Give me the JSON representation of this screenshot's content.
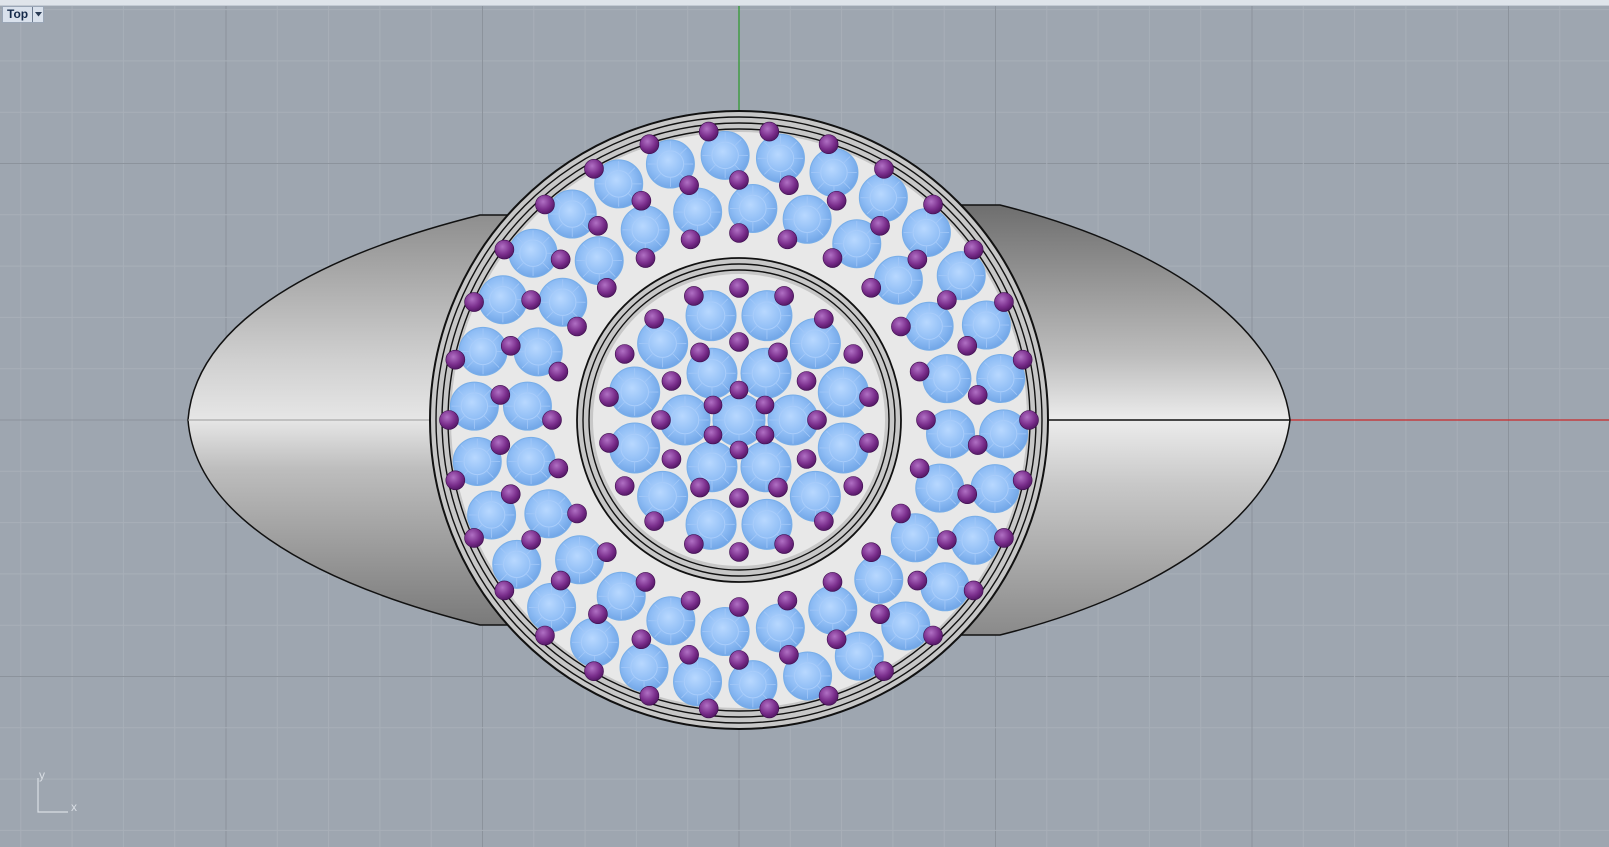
{
  "viewport": {
    "title": "Top",
    "menu_icon": "chevron-down-icon",
    "background_color": "#9ea6b0",
    "grid_minor_color": "#a8afb8",
    "grid_major_color": "#8c939c",
    "x_axis_color": "#cc2a2a",
    "y_axis_color": "#2a9a2a"
  },
  "axis_indicator": {
    "y_label": "y",
    "x_label": "x"
  },
  "model": {
    "metal_color": "#b8b8b8",
    "outline_color": "#111111",
    "main_stone_color": "#8fbdf5",
    "accent_stone_color": "#7a2e8c"
  }
}
